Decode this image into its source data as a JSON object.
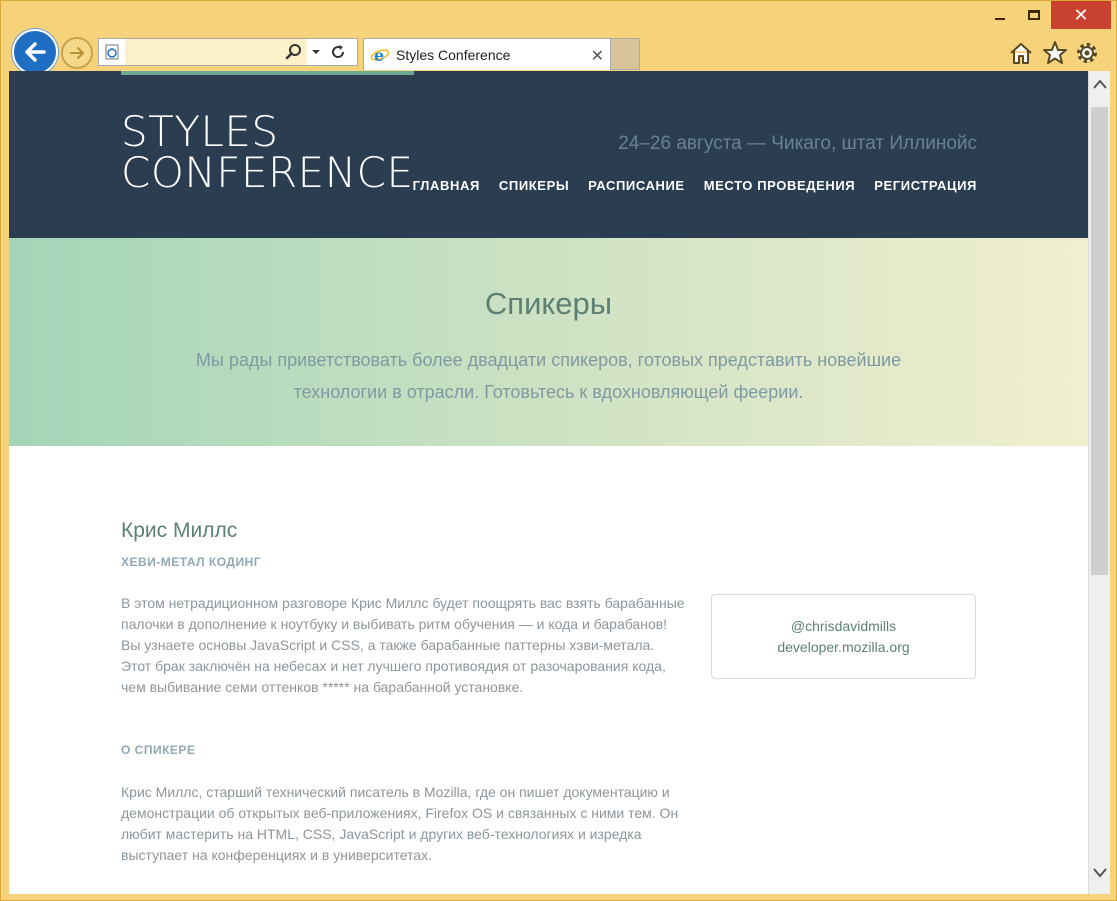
{
  "tab": {
    "title": "Styles Conference"
  },
  "addressbar": {
    "value": ""
  },
  "site": {
    "logo_line1": "STYLES",
    "logo_line2": "CONFERENCE",
    "tagline": "24–26 августа — Чикаго, штат Иллинойс",
    "nav": [
      {
        "label": "ГЛАВНАЯ"
      },
      {
        "label": "СПИКЕРЫ"
      },
      {
        "label": "РАСПИСАНИЕ"
      },
      {
        "label": "МЕСТО ПРОВЕДЕНИЯ"
      },
      {
        "label": "РЕГИСТРАЦИЯ"
      }
    ]
  },
  "hero": {
    "title": "Спикеры",
    "lead": "Мы рады приветствовать более двадцати спикеров, готовых представить новейшие технологии в отрасли. Готовьтесь к вдохновляющей феерии."
  },
  "speaker": {
    "name": "Крис Миллс",
    "talk_title": "ХЕВИ-МЕТАЛ КОДИНГ",
    "talk_desc": "В этом нетрадиционном разговоре Крис Миллс будет поощрять вас взять барабанные палочки в дополнение к ноутбуку и выбивать ритм обучения — и кода и барабанов! Вы узнаете основы JavaScript и CSS, а также барабанные паттерны хэви-метала. Этот брак заключён на небесах и нет лучшего противоядия от разочарования кода, чем выбивание семи оттенков ***** на барабанной установке.",
    "about_title": "О СПИКЕРЕ",
    "about_desc": "Крис Миллс, старший технический писатель в Mozilla, где он пишет документацию и демонстрации об открытых веб-приложениях, Firefox OS и связанных с ними тем. Он любит мастерить на HTML, CSS, JavaScript и других веб-технологиях и изредка выступает на конференциях и в университетах.",
    "twitter": "@chrisdavidmills",
    "website": "developer.mozilla.org"
  },
  "colors": {
    "header_bg": "#2a3d51",
    "accent_green": "#5c8174",
    "window_frame": "#f6d27a"
  }
}
